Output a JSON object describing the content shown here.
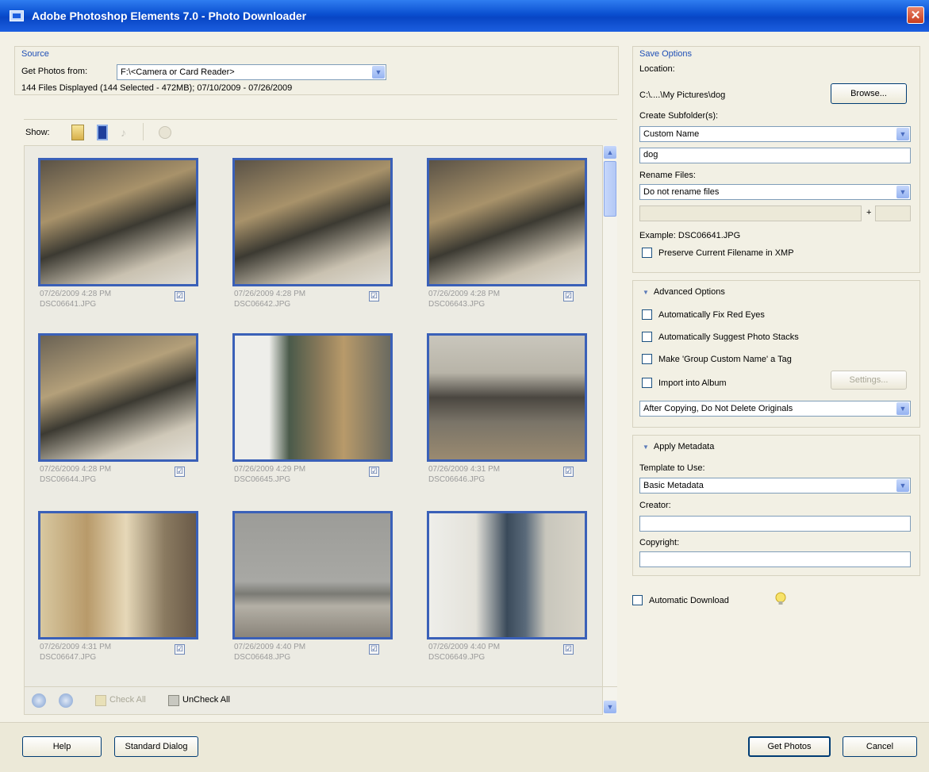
{
  "window": {
    "title": "Adobe Photoshop Elements 7.0 - Photo Downloader"
  },
  "source": {
    "group_title": "Source",
    "get_photos_label": "Get Photos from:",
    "get_photos_value": "F:\\<Camera or Card Reader>",
    "files_info": "144 Files Displayed (144 Selected - 472MB); 07/10/2009 - 07/26/2009",
    "show_label": "Show:"
  },
  "thumbnails": [
    {
      "date": "07/26/2009 4:28 PM",
      "file": "DSC06641.JPG",
      "checked": "☑"
    },
    {
      "date": "07/26/2009 4:28 PM",
      "file": "DSC06642.JPG",
      "checked": "☑"
    },
    {
      "date": "07/26/2009 4:28 PM",
      "file": "DSC06643.JPG",
      "checked": "☑"
    },
    {
      "date": "07/26/2009 4:28 PM",
      "file": "DSC06644.JPG",
      "checked": "☑"
    },
    {
      "date": "07/26/2009 4:29 PM",
      "file": "DSC06645.JPG",
      "checked": "☑"
    },
    {
      "date": "07/26/2009 4:31 PM",
      "file": "DSC06646.JPG",
      "checked": "☑"
    },
    {
      "date": "07/26/2009 4:31 PM",
      "file": "DSC06647.JPG",
      "checked": "☑"
    },
    {
      "date": "07/26/2009 4:40 PM",
      "file": "DSC06648.JPG",
      "checked": "☑"
    },
    {
      "date": "07/26/2009 4:40 PM",
      "file": "DSC06649.JPG",
      "checked": "☑"
    }
  ],
  "bottom_toolbar": {
    "check_all": "Check All",
    "uncheck_all": "UnCheck All"
  },
  "save_options": {
    "group_title": "Save Options",
    "location_label": "Location:",
    "location_value": "C:\\....\\My Pictures\\dog",
    "browse_button": "Browse...",
    "subfolder_label": "Create Subfolder(s):",
    "subfolder_value": "Custom Name",
    "custom_name_value": "dog",
    "rename_label": "Rename Files:",
    "rename_value": "Do not rename files",
    "plus_sign": "+",
    "example_text": "Example: DSC06641.JPG",
    "preserve_label": "Preserve Current Filename in XMP"
  },
  "advanced_options": {
    "title": "Advanced Options",
    "fix_red_eyes": "Automatically Fix Red Eyes",
    "suggest_stacks": "Automatically Suggest Photo Stacks",
    "make_tag": "Make 'Group Custom Name' a Tag",
    "import_album": "Import into Album",
    "settings_button": "Settings...",
    "after_copying_value": "After Copying, Do Not Delete Originals"
  },
  "apply_metadata": {
    "title": "Apply Metadata",
    "template_label": "Template to Use:",
    "template_value": "Basic Metadata",
    "creator_label": "Creator:",
    "copyright_label": "Copyright:"
  },
  "auto_download": {
    "label": "Automatic Download"
  },
  "footer": {
    "help": "Help",
    "standard_dialog": "Standard Dialog",
    "get_photos": "Get Photos",
    "cancel": "Cancel"
  }
}
